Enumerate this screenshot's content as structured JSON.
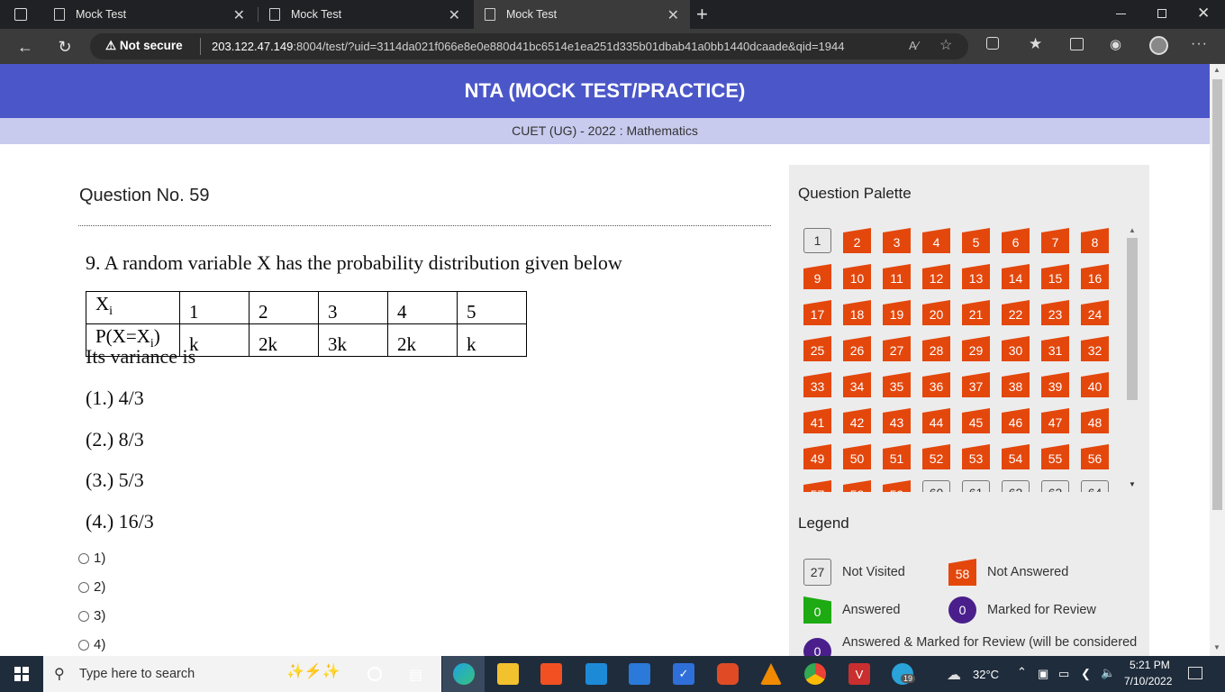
{
  "browser": {
    "tabs": [
      {
        "title": "Mock Test"
      },
      {
        "title": "Mock Test"
      },
      {
        "title": "Mock Test"
      }
    ],
    "not_secure": "Not secure",
    "url_host": "203.122.47.149",
    "url_rest": ":8004/test/?uid=3114da021f066e8e0e880d41bc6514e1ea251d335b01dbab41a0bb1440dcaade&qid=1944"
  },
  "header": {
    "title": "NTA (MOCK TEST/PRACTICE)",
    "subtitle": "CUET (UG) - 2022 : Mathematics"
  },
  "question": {
    "heading": "Question No. 59",
    "text": "9. A random variable X has the probability distribution given below",
    "table": {
      "row1_label": "X",
      "row1_sub": "i",
      "row1": [
        "1",
        "2",
        "3",
        "4",
        "5"
      ],
      "row2_label_a": "P(X=X",
      "row2_sub": "i",
      "row2_label_b": ")",
      "row2": [
        "k",
        "2k",
        "3k",
        "2k",
        "k"
      ]
    },
    "prompt": "Its variance is",
    "options": [
      "(1.) 4/3",
      "(2.) 8/3",
      "(3.) 5/3",
      "(4.) 16/3"
    ],
    "answer_choices": [
      "1)",
      "2)",
      "3)",
      "4)"
    ]
  },
  "palette": {
    "title": "Question Palette",
    "not_visited": [
      1,
      60,
      61,
      62,
      63,
      64
    ],
    "count_visible_rows": 8,
    "na_color": "#e4470c"
  },
  "legend": {
    "title": "Legend",
    "not_visited_count": "27",
    "not_visited_label": "Not Visited",
    "not_answered_count": "58",
    "not_answered_label": "Not Answered",
    "answered_count": "0",
    "answered_label": "Answered",
    "marked_count": "0",
    "marked_label": "Marked for Review",
    "answered_marked_count": "0",
    "answered_marked_label": "Answered & Marked for Review (will be considered"
  },
  "taskbar": {
    "search_placeholder": "Type here to search",
    "temperature": "32°C",
    "time": "5:21 PM",
    "date": "7/10/2022",
    "badge": "19"
  }
}
